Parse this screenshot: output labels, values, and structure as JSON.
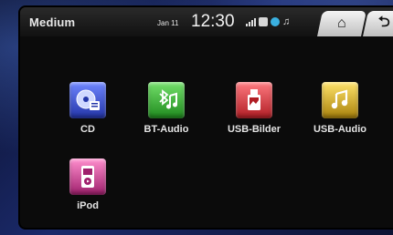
{
  "status": {
    "source_title": "Medium",
    "date": "Jan 11",
    "time": "12:30"
  },
  "nav": {
    "home_icon": "home-icon",
    "back_icon": "back-icon"
  },
  "apps": [
    {
      "label": "CD",
      "icon": "cd-icon",
      "color": "#3a4fd0"
    },
    {
      "label": "BT-Audio",
      "icon": "bluetooth-audio-icon",
      "color": "#3fae3a"
    },
    {
      "label": "USB-Bilder",
      "icon": "usb-picture-icon",
      "color": "#d8363c"
    },
    {
      "label": "USB-Audio",
      "icon": "usb-audio-icon",
      "color": "#c9a317"
    },
    {
      "label": "iPod",
      "icon": "ipod-icon",
      "color": "#c83a8e"
    }
  ]
}
